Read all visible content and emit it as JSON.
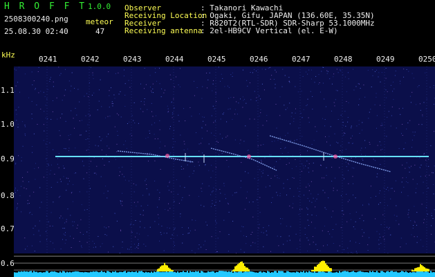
{
  "app": {
    "title_letters": "H R O F F T",
    "version": "1.0.0"
  },
  "file": {
    "name": "2508300240.png",
    "datetime": "25.08.30 02:40"
  },
  "meteor": {
    "label": "meteor",
    "count": "47"
  },
  "info": [
    {
      "label": "Observer",
      "value": ": Takanori Kawachi"
    },
    {
      "label": "Receiving Location",
      "value": ": Ogaki, Gifu, JAPAN (136.60E, 35.35N)"
    },
    {
      "label": "Receiver",
      "value": ": R820T2(RTL-SDR) SDR-Sharp 53.1000MHz"
    },
    {
      "label": "Receiving antenna",
      "value": ": 2el-HB9CV Vertical (el. E-W)"
    }
  ],
  "axis": {
    "unit": "kHz",
    "time_ticks": [
      "0241",
      "0242",
      "0243",
      "0244",
      "0245",
      "0246",
      "0247",
      "0248",
      "0249",
      "0250"
    ],
    "freq_ticks": [
      "1.1",
      "1.0",
      "0.9",
      "0.8",
      "0.7",
      "0.6"
    ]
  },
  "colors": {
    "text_green": "#33ee33",
    "text_white": "#f0f0f0",
    "text_yellow": "#ffff55",
    "spectrogram_bg": "#0b0f4a",
    "carrier": "#66e0ff",
    "histogram_cyan": "#22c8ff",
    "histogram_yellow": "#ffee00"
  }
}
